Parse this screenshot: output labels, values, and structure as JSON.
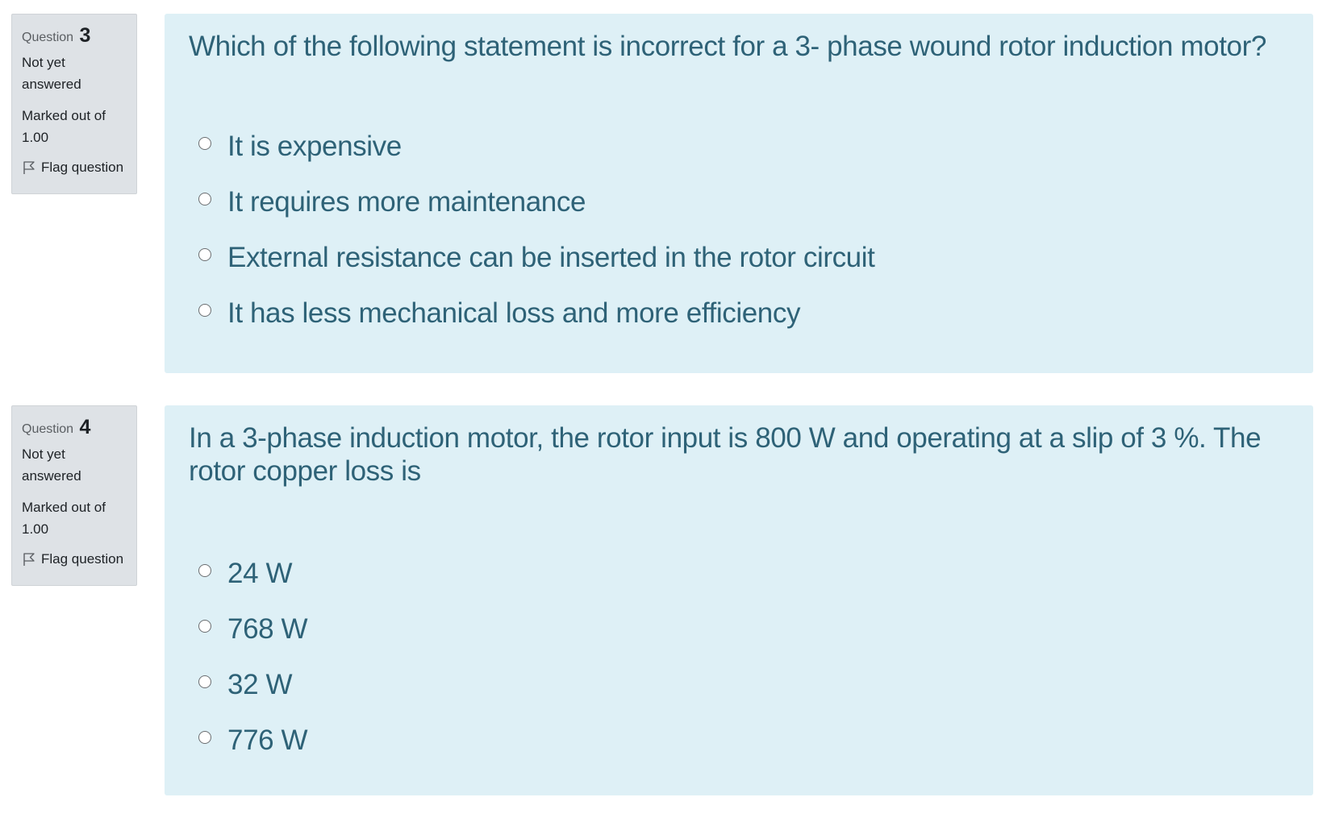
{
  "questions": [
    {
      "prefix": "Question",
      "number": "3",
      "state": "Not yet answered",
      "grade": "Marked out of 1.00",
      "flag_label": "Flag question",
      "text": "Which of the following statement is incorrect for a 3- phase wound rotor induction motor?",
      "options": [
        "It is expensive",
        "It requires more maintenance",
        "External resistance can be inserted in the rotor circuit",
        "It has less mechanical loss and more efficiency"
      ]
    },
    {
      "prefix": "Question",
      "number": "4",
      "state": "Not yet answered",
      "grade": "Marked out of 1.00",
      "flag_label": "Flag question",
      "text": "In a 3-phase induction motor, the rotor input is 800 W and operating at a slip of 3 %. The rotor copper loss is",
      "options": [
        "24 W",
        "768 W",
        "32 W",
        "776 W"
      ]
    }
  ],
  "icons": {
    "flag": "flag-outline-icon",
    "radio": "radio-unchecked"
  },
  "colors": {
    "info_bg": "#dee2e6",
    "content_bg": "#def0f6",
    "question_text": "#2e6277"
  }
}
